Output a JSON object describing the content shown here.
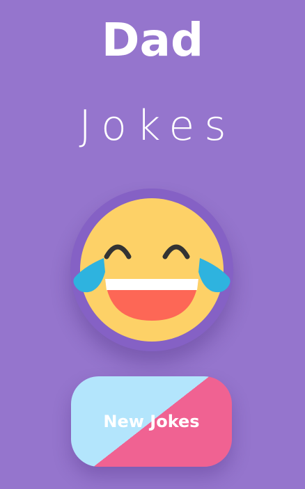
{
  "header": {
    "title_bold": "Dad",
    "title_light": "Jokes"
  },
  "emoji": {
    "icon": "face-with-tears-of-joy-icon",
    "face_color": "#fdd167",
    "ring_color": "#8561c5",
    "tear_color": "#2eb3df",
    "mouth_color": "#fd6756",
    "teeth_color": "#ffffff",
    "eye_color": "#333333"
  },
  "action": {
    "button_label": "New Jokes",
    "gradient_left": "#b3e5fc",
    "gradient_right": "#f06292"
  },
  "theme": {
    "background": "#9575cd",
    "text": "#ffffff"
  }
}
